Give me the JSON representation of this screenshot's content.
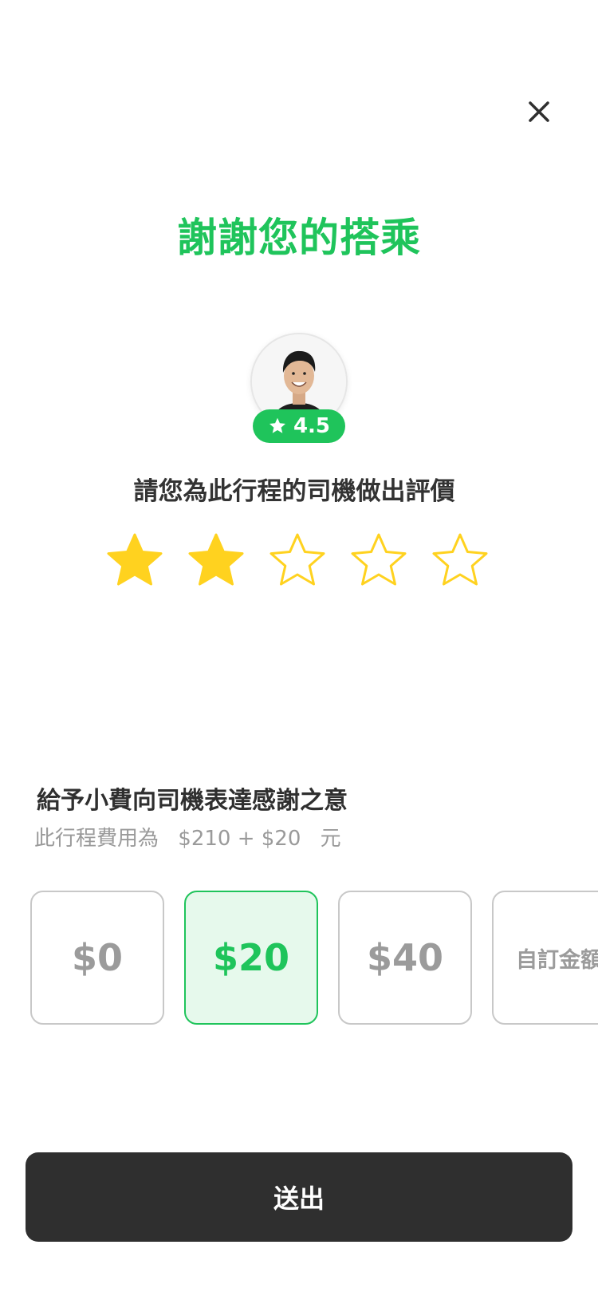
{
  "header": {
    "close_icon": "close-icon",
    "title": "謝謝您的搭乘"
  },
  "driver": {
    "avatar": "driver-avatar-photo",
    "rating": "4.5",
    "rating_icon": "star-icon"
  },
  "rating_prompt": "請您為此行程的司機做出評價",
  "stars": {
    "max": 5,
    "selected": 2,
    "filled_color": "#FFD21F"
  },
  "tip": {
    "title": "給予小費向司機表達感謝之意",
    "fare_prefix": "此行程費用為",
    "fare_amount": "$210 + $20",
    "fare_suffix": "元",
    "options": [
      {
        "label": "$0",
        "selected": false
      },
      {
        "label": "$20",
        "selected": true
      },
      {
        "label": "$40",
        "selected": false
      },
      {
        "label": "自訂金額",
        "selected": false
      }
    ]
  },
  "submit_label": "送出",
  "colors": {
    "brand_green": "#1FC45B",
    "selected_tip_bg": "#E6F9EC",
    "submit_bg": "#2F2F2F"
  }
}
